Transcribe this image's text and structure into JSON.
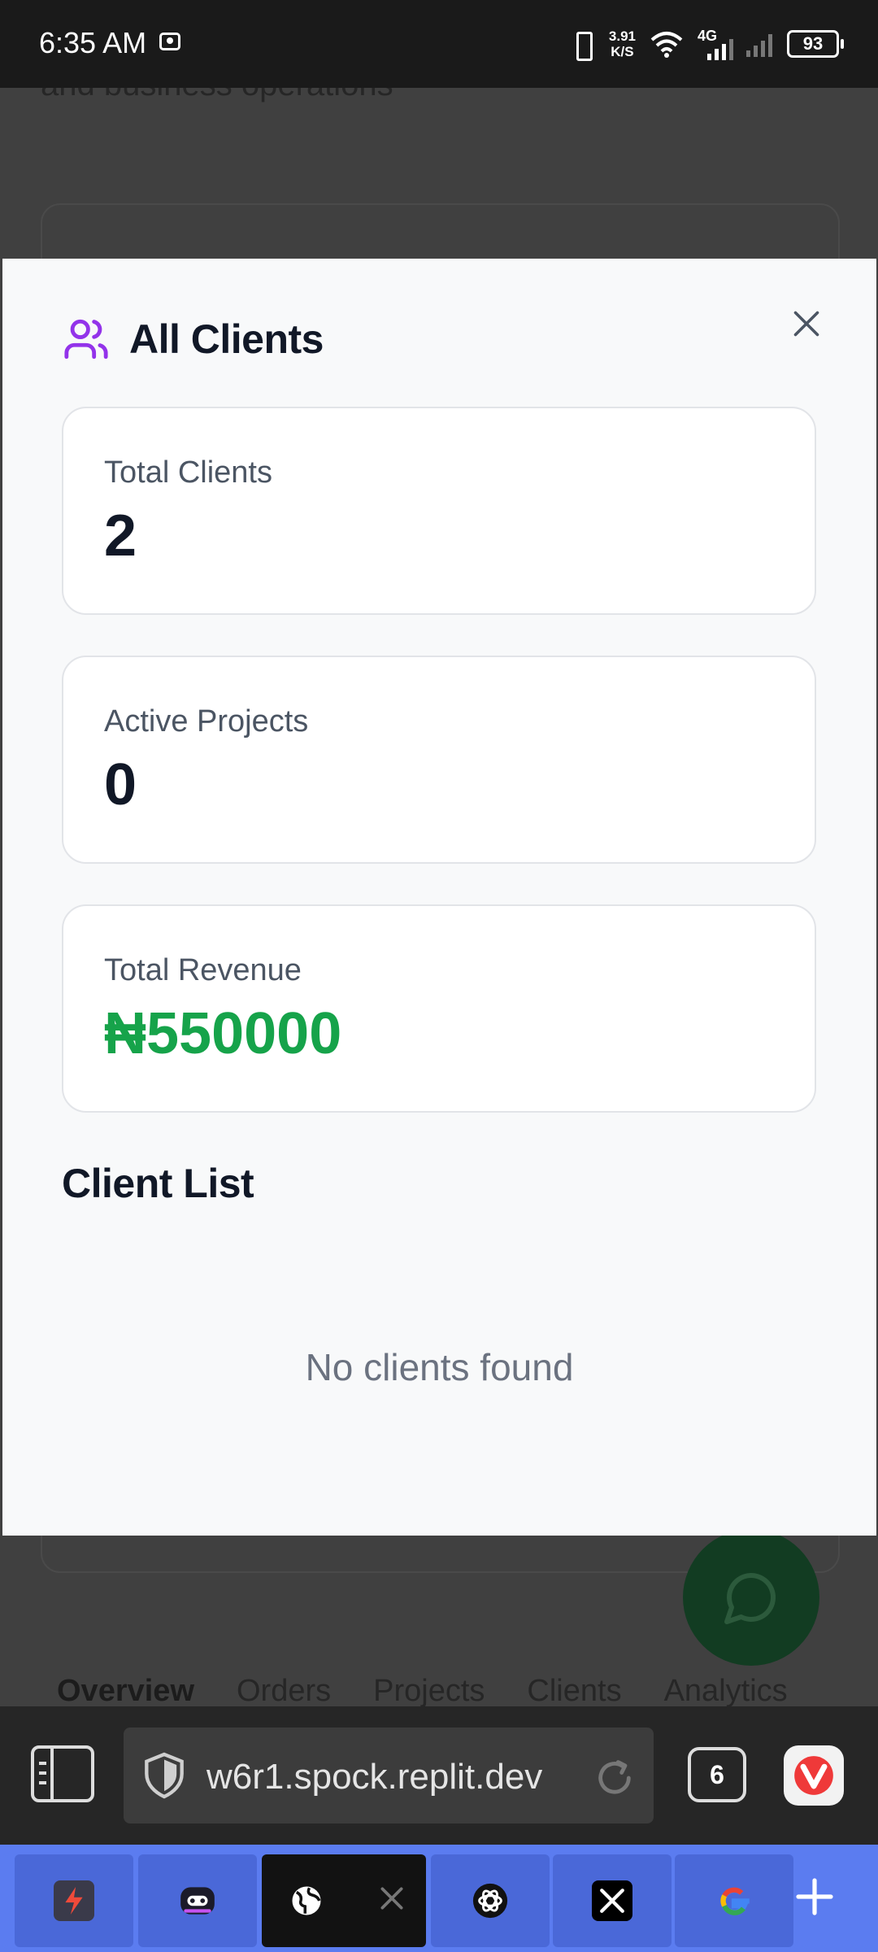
{
  "status_bar": {
    "time": "6:35 AM",
    "net_speed_value": "3.91",
    "net_speed_unit": "K/S",
    "network_type": "4G",
    "battery": "93"
  },
  "background_page": {
    "subtitle": "and business operations",
    "tabs": [
      "Overview",
      "Orders",
      "Projects",
      "Clients",
      "Analytics"
    ]
  },
  "modal": {
    "title": "All Clients",
    "title_icon": "users-icon",
    "stats": [
      {
        "label": "Total Clients",
        "value": "2"
      },
      {
        "label": "Active Projects",
        "value": "0"
      },
      {
        "label": "Total Revenue",
        "value": "₦550000",
        "color": "#16a34a"
      }
    ],
    "list_title": "Client List",
    "empty_message": "No clients found"
  },
  "browser": {
    "url": "w6r1.spock.replit.dev",
    "tab_count": "6"
  },
  "tab_strip": {
    "tabs": [
      {
        "icon": "app-bolt-icon"
      },
      {
        "icon": "bot-icon"
      },
      {
        "icon": "globe-icon",
        "active": true
      },
      {
        "icon": "chatgpt-icon"
      },
      {
        "icon": "x-icon"
      },
      {
        "icon": "google-icon"
      }
    ]
  },
  "colors": {
    "accent_purple": "#9333ea",
    "revenue_green": "#16a34a",
    "tab_strip_blue": "#5b7cf0"
  }
}
